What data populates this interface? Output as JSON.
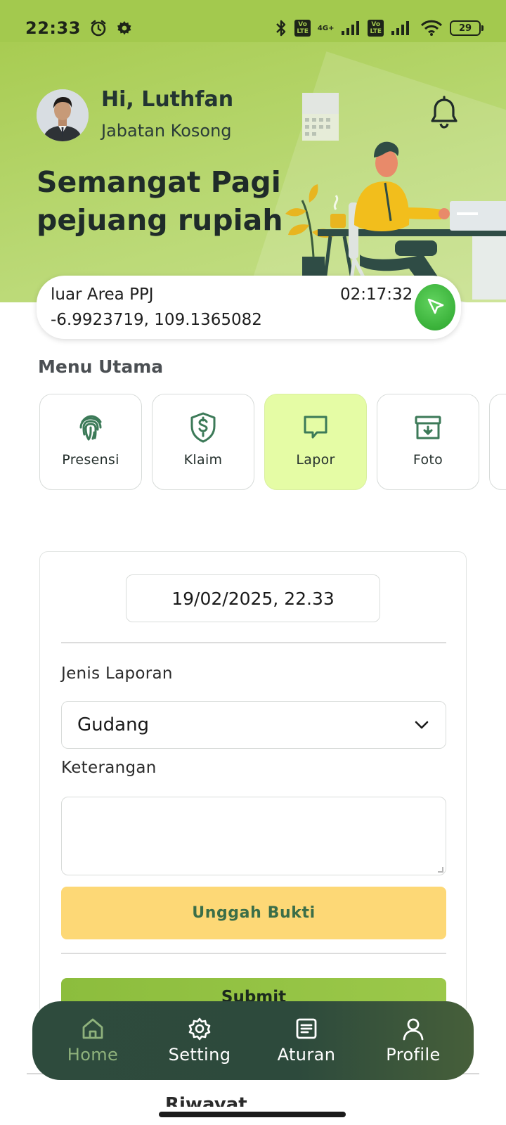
{
  "status_bar": {
    "time": "22:33",
    "icons": [
      "alarm-icon",
      "settings-gear-icon",
      "bluetooth-icon",
      "volte-icon",
      "signal-icon",
      "volte-icon",
      "signal-icon",
      "wifi-icon"
    ],
    "net_badge_1": "Vo\nLTE",
    "net_tag": "4G+",
    "net_badge_2": "Vo\nLTE",
    "battery": "29"
  },
  "header": {
    "greeting_name": "Hi, Luthfan",
    "position": "Jabatan Kosong",
    "headline_line1": "Semangat Pagi",
    "headline_line2": "pejuang rupiah",
    "background_color": "#a8cc52"
  },
  "location": {
    "area": "luar Area PPJ",
    "time": "02:17:32",
    "coordinates": "-6.9923719, 109.1365082",
    "button_color": "#3ab23a"
  },
  "menu": {
    "title": "Menu Utama",
    "items": [
      {
        "label": "Presensi",
        "icon": "fingerprint-icon"
      },
      {
        "label": "Klaim",
        "icon": "shield-dollar-icon"
      },
      {
        "label": "Lapor",
        "icon": "message-square-icon",
        "active": true
      },
      {
        "label": "Foto",
        "icon": "archive-download-icon"
      }
    ]
  },
  "form": {
    "datetime": "19/02/2025, 22.33",
    "report_type_label": "Jenis Laporan",
    "report_type_value": "Gudang",
    "notes_label": "Keterangan",
    "notes_value": "",
    "upload_label": "Unggah Bukti",
    "submit_label": "Submit",
    "upload_color": "#fdd876",
    "submit_color": "#8cbd3d"
  },
  "bottom_section": {
    "title": "Riwayat"
  },
  "bottom_nav": {
    "items": [
      {
        "label": "Home",
        "icon": "home-icon",
        "active": true
      },
      {
        "label": "Setting",
        "icon": "gear-icon"
      },
      {
        "label": "Aturan",
        "icon": "document-icon"
      },
      {
        "label": "Profile",
        "icon": "user-icon"
      }
    ]
  }
}
